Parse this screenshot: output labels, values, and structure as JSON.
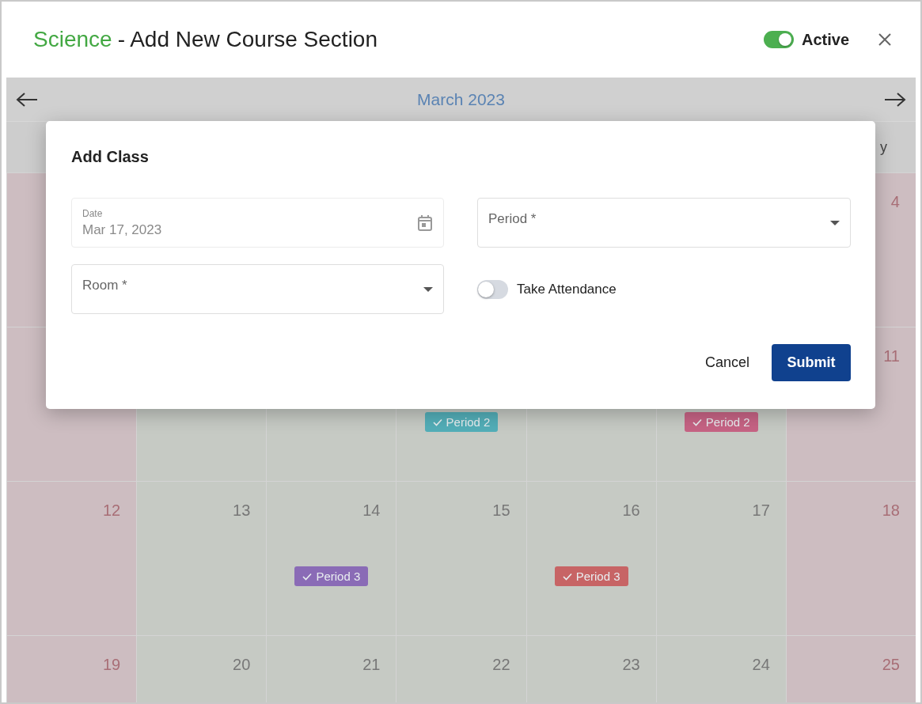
{
  "header": {
    "subject": "Science",
    "title": "- Add New Course Section",
    "active_toggle": {
      "label": "Active",
      "on": true
    }
  },
  "calendar": {
    "month": "March 2023",
    "weekday_header": "y",
    "weeks": [
      {
        "days": [
          {
            "weekend": true
          },
          {
            "weekend": true,
            "date": "4"
          }
        ]
      },
      {
        "days": [
          {
            "weekend": true
          },
          {
            "weekend": false
          },
          {
            "weekend": false
          },
          {
            "weekend": false,
            "events": [
              {
                "label": "Period 2",
                "color": "#53aeb8"
              }
            ]
          },
          {
            "weekend": false
          },
          {
            "weekend": false,
            "events": [
              {
                "label": "Period 2",
                "color": "#c66384"
              }
            ]
          },
          {
            "weekend": true,
            "date": "11"
          }
        ]
      },
      {
        "days": [
          {
            "weekend": true,
            "date": "12"
          },
          {
            "weekend": false,
            "date": "13"
          },
          {
            "weekend": false,
            "date": "14",
            "events": [
              {
                "label": "Period 3",
                "color": "#8a6bb6"
              }
            ]
          },
          {
            "weekend": false,
            "date": "15"
          },
          {
            "weekend": false,
            "date": "16",
            "events": [
              {
                "label": "Period 3",
                "color": "#c76465"
              }
            ]
          },
          {
            "weekend": false,
            "date": "17"
          },
          {
            "weekend": true,
            "date": "18"
          }
        ]
      },
      {
        "days": [
          {
            "weekend": true,
            "date": "19"
          },
          {
            "weekend": false,
            "date": "20"
          },
          {
            "weekend": false,
            "date": "21"
          },
          {
            "weekend": false,
            "date": "22"
          },
          {
            "weekend": false,
            "date": "23"
          },
          {
            "weekend": false,
            "date": "24"
          },
          {
            "weekend": true,
            "date": "25"
          }
        ]
      }
    ]
  },
  "modal": {
    "title": "Add Class",
    "fields": [
      {
        "kind": "date",
        "label": "Date",
        "value": "Mar 17, 2023",
        "disabled": true
      },
      {
        "kind": "select",
        "placeholder": "Period *"
      },
      {
        "kind": "select",
        "placeholder": "Room *"
      },
      {
        "kind": "switch",
        "label": "Take Attendance",
        "on": false
      }
    ],
    "buttons": [
      {
        "label": "Cancel",
        "kind": "text"
      },
      {
        "label": "Submit",
        "kind": "primary"
      }
    ]
  }
}
